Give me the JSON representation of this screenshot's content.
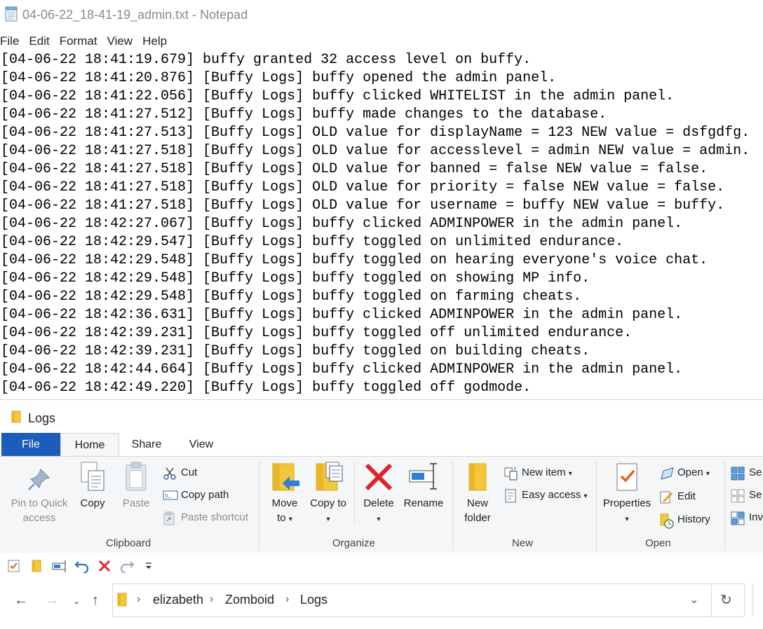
{
  "notepad": {
    "title": "04-06-22_18-41-19_admin.txt - Notepad",
    "menu": [
      "File",
      "Edit",
      "Format",
      "View",
      "Help"
    ],
    "lines": [
      "[04-06-22 18:41:19.679] buffy granted 32 access level on buffy.",
      "[04-06-22 18:41:20.876] [Buffy Logs] buffy opened the admin panel.",
      "[04-06-22 18:41:22.056] [Buffy Logs] buffy clicked WHITELIST in the admin panel.",
      "[04-06-22 18:41:27.512] [Buffy Logs] buffy made changes to the database.",
      "[04-06-22 18:41:27.513] [Buffy Logs] OLD value for displayName = 123 NEW value = dsfgdfg.",
      "[04-06-22 18:41:27.518] [Buffy Logs] OLD value for accesslevel = admin NEW value = admin.",
      "[04-06-22 18:41:27.518] [Buffy Logs] OLD value for banned = false NEW value = false.",
      "[04-06-22 18:41:27.518] [Buffy Logs] OLD value for priority = false NEW value = false.",
      "[04-06-22 18:41:27.518] [Buffy Logs] OLD value for username = buffy NEW value = buffy.",
      "[04-06-22 18:42:27.067] [Buffy Logs] buffy clicked ADMINPOWER in the admin panel.",
      "[04-06-22 18:42:29.547] [Buffy Logs] buffy toggled on unlimited endurance.",
      "[04-06-22 18:42:29.548] [Buffy Logs] buffy toggled on hearing everyone's voice chat.",
      "[04-06-22 18:42:29.548] [Buffy Logs] buffy toggled on showing MP info.",
      "[04-06-22 18:42:29.548] [Buffy Logs] buffy toggled on farming cheats.",
      "[04-06-22 18:42:36.631] [Buffy Logs] buffy clicked ADMINPOWER in the admin panel.",
      "[04-06-22 18:42:39.231] [Buffy Logs] buffy toggled off unlimited endurance.",
      "[04-06-22 18:42:39.231] [Buffy Logs] buffy toggled on building cheats.",
      "[04-06-22 18:42:44.664] [Buffy Logs] buffy clicked ADMINPOWER in the admin panel.",
      "[04-06-22 18:42:49.220] [Buffy Logs] buffy toggled off godmode."
    ]
  },
  "explorer": {
    "title": "Logs",
    "tabs": {
      "file": "File",
      "home": "Home",
      "share": "Share",
      "view": "View"
    },
    "clipboard": {
      "pin": "Pin to Quick access",
      "copy": "Copy",
      "paste": "Paste",
      "cut": "Cut",
      "copy_path": "Copy path",
      "paste_shortcut": "Paste shortcut",
      "label": "Clipboard"
    },
    "organize": {
      "move_to": "Move to",
      "copy_to": "Copy to",
      "delete": "Delete",
      "rename": "Rename",
      "label": "Organize"
    },
    "new": {
      "new_folder": "New folder",
      "new_item": "New item",
      "easy_access": "Easy access",
      "label": "New"
    },
    "open": {
      "properties": "Properties",
      "open": "Open",
      "edit": "Edit",
      "history": "History",
      "label": "Open"
    },
    "select": {
      "select_all": "Se",
      "select_none": "Se",
      "invert": "Inv"
    },
    "breadcrumb": [
      "elizabeth",
      "Zomboid",
      "Logs"
    ]
  }
}
